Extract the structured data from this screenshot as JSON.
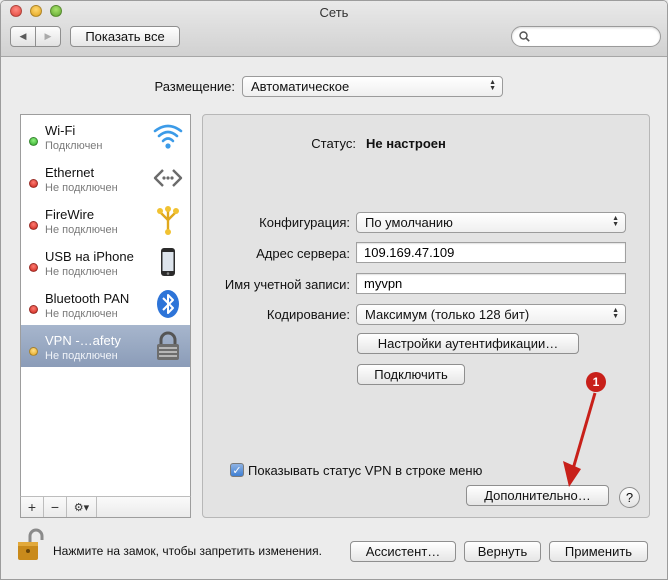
{
  "window": {
    "title": "Сеть"
  },
  "toolbar": {
    "show_all_label": "Показать все",
    "search_value": ""
  },
  "location": {
    "label": "Размещение:",
    "value": "Автоматическое"
  },
  "services": [
    {
      "name": "Wi-Fi",
      "status": "Подключен",
      "status_color": "#2fa52a",
      "icon": "wifi-icon"
    },
    {
      "name": "Ethernet",
      "status": "Не подключен",
      "status_color": "#c9231a",
      "icon": "ethernet-icon"
    },
    {
      "name": "FireWire",
      "status": "Не подключен",
      "status_color": "#c9231a",
      "icon": "firewire-icon"
    },
    {
      "name": "USB на iPhone",
      "status": "Не подключен",
      "status_color": "#c9231a",
      "icon": "iphone-icon"
    },
    {
      "name": "Bluetooth PAN",
      "status": "Не подключен",
      "status_color": "#c9231a",
      "icon": "bluetooth-icon"
    },
    {
      "name": "VPN -…afety",
      "status": "Не подключен",
      "status_color": "#e3a31c",
      "icon": "vpn-lock-icon",
      "selected": true
    }
  ],
  "sidebar_controls": {
    "add": "+",
    "remove": "−",
    "gear": "⚙▾"
  },
  "vpn": {
    "status_label": "Статус:",
    "status_value": "Не настроен",
    "config_label": "Конфигурация:",
    "config_value": "По умолчанию",
    "server_label": "Адрес сервера:",
    "server_value": "109.169.47.109",
    "account_label": "Имя учетной записи:",
    "account_value": "myvpn",
    "encryption_label": "Кодирование:",
    "encryption_value": "Максимум (только 128 бит)",
    "auth_button": "Настройки аутентификации…",
    "connect_button": "Подключить",
    "show_status_label": "Показывать статус VPN в строке меню",
    "show_status_checked": true,
    "advanced_button": "Дополнительно…",
    "help_label": "?"
  },
  "annotation": {
    "badge": "1",
    "color": "#c8201a"
  },
  "footer": {
    "lock_text": "Нажмите на замок, чтобы запретить изменения.",
    "assistant_button": "Ассистент…",
    "revert_button": "Вернуть",
    "apply_button": "Применить"
  }
}
